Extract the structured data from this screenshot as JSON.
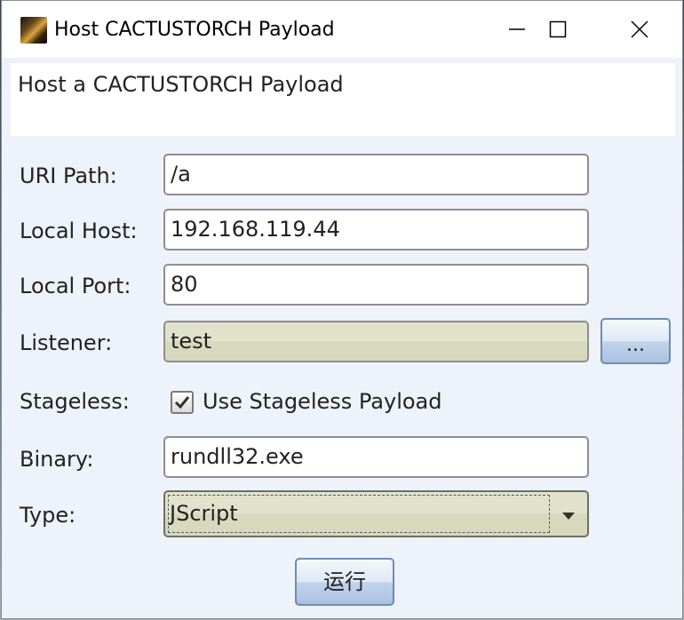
{
  "window": {
    "title": "Host CACTUSTORCH Payload",
    "minimize_icon": "minimize-icon",
    "maximize_icon": "maximize-icon",
    "close_icon": "close-icon"
  },
  "banner": {
    "text": "Host a CACTUSTORCH Payload"
  },
  "form": {
    "uri_path": {
      "label": "URI Path:",
      "value": "/a"
    },
    "local_host": {
      "label": "Local Host:",
      "value": "192.168.119.44"
    },
    "local_port": {
      "label": "Local Port:",
      "value": "80"
    },
    "listener": {
      "label": "Listener:",
      "value": "test",
      "browse_label": "..."
    },
    "stageless": {
      "label": "Stageless:",
      "checkbox_label": "Use Stageless Payload",
      "checked": true
    },
    "binary": {
      "label": "Binary:",
      "value": "rundll32.exe"
    },
    "type": {
      "label": "Type:",
      "selected": "JScript"
    }
  },
  "actions": {
    "run_label": "运行"
  },
  "colors": {
    "window_bg": "#eef2fa",
    "field_readonly_bg": "#e0e2cc",
    "button_border": "#6d8cb5"
  }
}
